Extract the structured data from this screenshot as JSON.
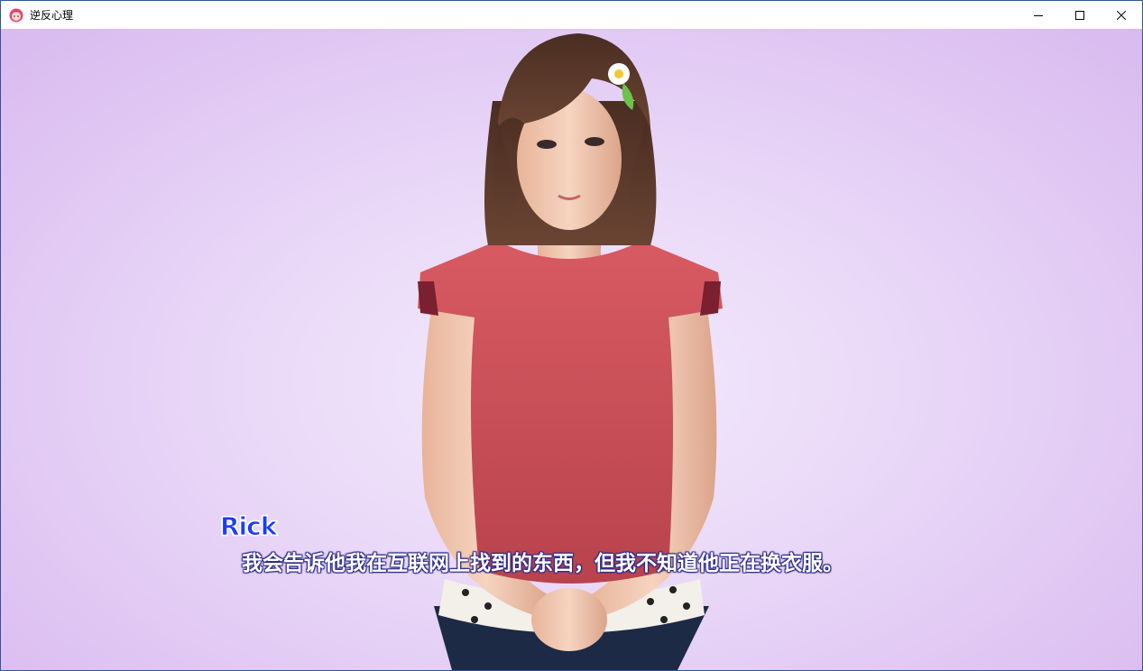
{
  "window": {
    "title": "逆反心理",
    "icon": "app-icon",
    "controls": [
      "minimize-icon",
      "maximize-icon",
      "close-icon"
    ]
  },
  "dialogue": {
    "speaker": "Rick",
    "text": "我会告诉他我在互联网上找到的东西，但我不知道他正在换衣服。"
  },
  "colors": {
    "background": "#ead9f8",
    "speaker_name": "#1a3cff",
    "dialogue_text": "#ffffff",
    "shirt": "#c8505a"
  }
}
